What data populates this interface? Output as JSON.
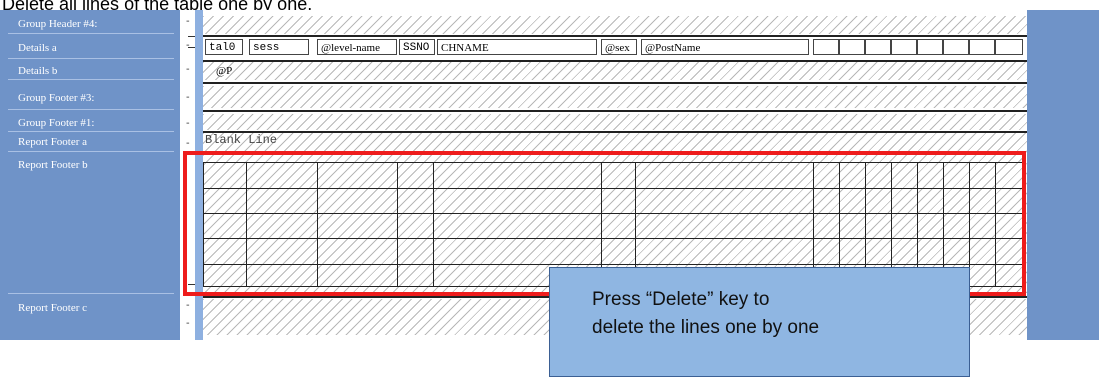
{
  "instruction": {
    "text": "Delete all lines of the table one by one."
  },
  "sections": [
    {
      "label": "Group Header #4:"
    },
    {
      "label": "Details a"
    },
    {
      "label": "Details b"
    },
    {
      "label": "Group Footer #3:"
    },
    {
      "label": "Group Footer #1:"
    },
    {
      "label": "Report Footer a"
    },
    {
      "label": "Report Footer b"
    },
    {
      "label": "Report Footer c"
    }
  ],
  "details_a_fields": [
    "tal0",
    "sess",
    "@level-name",
    "SSNO",
    "CHNAME",
    "@sex",
    "@PostName"
  ],
  "details_b_field": "@P",
  "report_footer_a_text": "Blank Line",
  "callout": {
    "text": "Press “Delete” key to\ndelete the lines one by one"
  },
  "colors": {
    "frame": "#6f93c8",
    "highlight": "#ee1c1c",
    "callout_bg": "#8fb6e2"
  }
}
